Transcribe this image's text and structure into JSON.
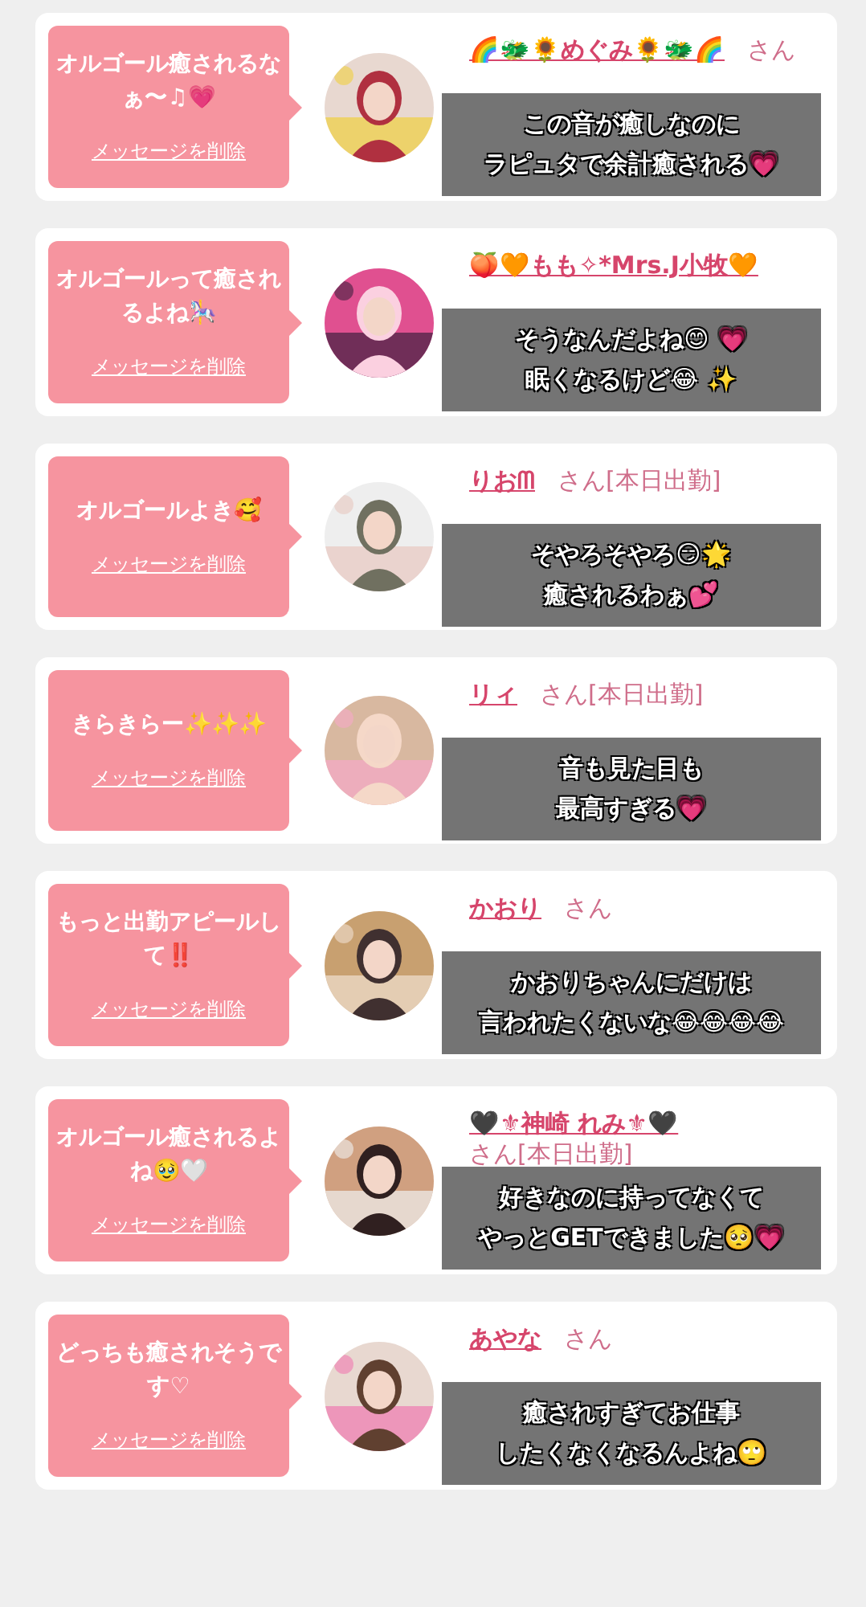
{
  "cards": [
    {
      "message": "オルゴール癒されるなぁ〜♫💗",
      "delete_link": "メッセージを削除",
      "name": "🌈🐲🌻めぐみ🌻🐲🌈",
      "suffix": "さん",
      "caption": [
        "この音が癒しなのに",
        "ラピュタで余計癒される💗"
      ]
    },
    {
      "message": "オルゴールって癒されるよね🎠",
      "delete_link": "メッセージを削除",
      "name": "🍑🧡もも✧*Mrs.J小牧🧡",
      "caption": [
        "そうなんだよね😊 💗",
        "眠くなるけど😂 ✨"
      ]
    },
    {
      "message": "オルゴールよき🥰",
      "delete_link": "メッセージを削除",
      "name": "りおᗰ",
      "suffix": "さん[本日出勤]",
      "caption": [
        "そやろそやろ😏🌟",
        "癒されるわぁ💕"
      ]
    },
    {
      "message": "きらきらー✨✨✨",
      "delete_link": "メッセージを削除",
      "name": "リィ",
      "suffix": "さん[本日出勤]",
      "caption": [
        "音も見た目も",
        "最高すぎる💗"
      ]
    },
    {
      "message": "もっと出勤アピールして‼️",
      "delete_link": "メッセージを削除",
      "name": "かおり",
      "suffix": "さん",
      "caption": [
        "かおりちゃんにだけは",
        "言われたくないな😂😂😂😂"
      ]
    },
    {
      "message": "オルゴール癒されるよね🥹🤍",
      "delete_link": "メッセージを削除",
      "name": "🖤⚜神崎 れみ⚜🖤",
      "suffix": "さん[本日出勤]",
      "caption": [
        "好きなのに持ってなくて",
        "やっとGETできました🥺💗"
      ]
    },
    {
      "message": "どっちも癒されそうです♡",
      "delete_link": "メッセージを削除",
      "name": "あやな",
      "suffix": "さん",
      "caption": [
        "癒されすぎてお仕事",
        "したくなくなるんよね🙄"
      ]
    }
  ]
}
